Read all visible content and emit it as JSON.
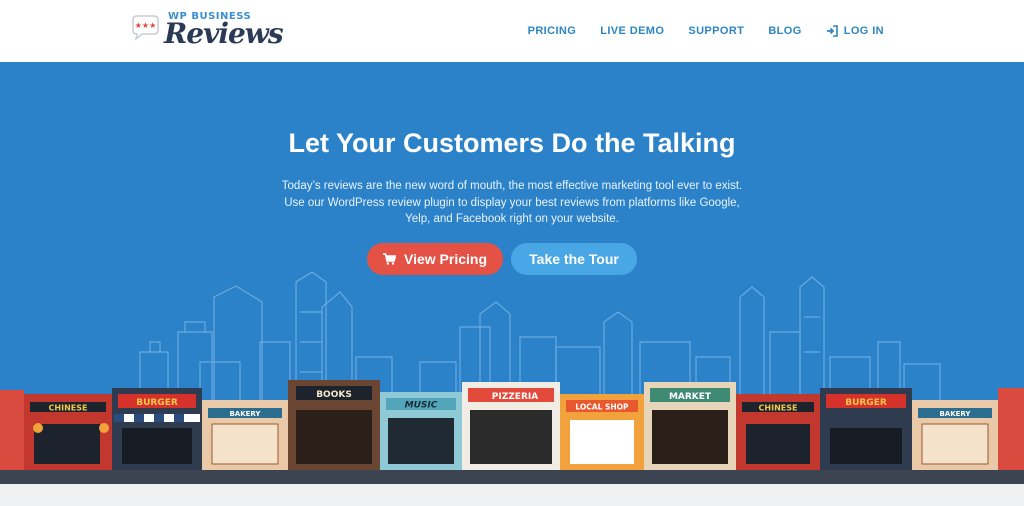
{
  "brand": {
    "top_text": "WP BUSINESS",
    "main_text": "Reviews",
    "logo_icon": "speech-bubble-stars-icon"
  },
  "nav": {
    "items": [
      {
        "label": "PRICING"
      },
      {
        "label": "LIVE DEMO"
      },
      {
        "label": "SUPPORT"
      },
      {
        "label": "BLOG"
      },
      {
        "label": "LOG IN",
        "icon": "login-icon"
      }
    ]
  },
  "hero": {
    "title": "Let Your Customers Do the Talking",
    "description": "Today’s reviews are the new word of mouth, the most effective marketing tool ever to exist. Use our WordPress review plugin to display your best reviews from platforms like Google, Yelp, and Facebook right on your website.",
    "primary_button": {
      "label": "View Pricing",
      "icon": "cart-icon"
    },
    "secondary_button": {
      "label": "Take the Tour"
    }
  },
  "storefronts": {
    "signs": [
      "CHINESE",
      "BURGER",
      "BAKERY",
      "BOOKS",
      "MUSIC",
      "PIZZERIA",
      "LOCAL SHOP",
      "MARKET",
      "CHINESE",
      "BURGER",
      "BAKERY"
    ]
  },
  "colors": {
    "hero_bg": "#2b82c9",
    "nav_link": "#2e86c1",
    "primary_button": "#e35245",
    "secondary_button": "#49a7e6"
  }
}
